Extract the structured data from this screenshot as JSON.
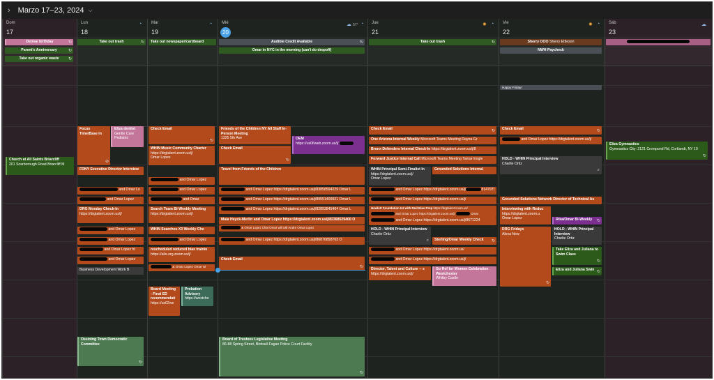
{
  "header": {
    "title": "Marzo 17–23, 2024",
    "prev_icon": "chevron-right-icon",
    "dropdown_icon": "chevron-down-icon"
  },
  "days": [
    {
      "name": "Dom",
      "num": "17"
    },
    {
      "name": "Lun",
      "num": "18"
    },
    {
      "name": "Mar",
      "num": "19"
    },
    {
      "name": "Mié",
      "num": "20",
      "weather": "57°"
    },
    {
      "name": "Jue",
      "num": "21"
    },
    {
      "name": "Vie",
      "num": "22"
    },
    {
      "name": "Sáb",
      "num": "23"
    }
  ],
  "allday": {
    "sun_1": "Denise birthday",
    "sun_2": "Parent's Anniversary",
    "sun_3": "Take out organic waste",
    "mon_1": "Take out trash",
    "tue_1": "Take out newspaper/cardboard",
    "wed_1": "Audible Credit Available",
    "wed_2": "Omar in NYC in the morning (can't do dropoff)",
    "thu_1": "Take out trash",
    "fri_1": "Sherry OOO",
    "fri_1b": "Sherry Ettleson",
    "fri_2": "NWH Paycheck",
    "fri_3": "Happy Friday!"
  },
  "events": {
    "sun_church_t": "Church at All Saints Briarcliff",
    "sun_church_l": "201 Scarborough Road Briarcliff M",
    "mon_focus_t": "Focus",
    "mon_focus_l": "Time/Base In",
    "mon_dentist_t": "Eliza dentist",
    "mon_dentist_l1": "Gentle Care",
    "mon_dentist_l2": "Pediatric",
    "mon_fdny": "FDNY Executive Director Interview",
    "mon_omar1": "and Omar Lo",
    "mon_omar2": "and Omar Lopez",
    "mon_drg_t": "DRG Monday Check-In",
    "mon_drg_l": "https://drgtalent.zoom.us/j/",
    "mon_omar3": "and Omar Lopez",
    "mon_omar4": "and Omar Lopez",
    "mon_omar5": "and Omar Lopez ht",
    "mon_omar6": "and Omar Lopez",
    "mon_bd": "Business Development Work B",
    "mon_ossining_t": "Ossining Town Democratic",
    "mon_ossining_t2": "Committee",
    "tue_check": "Check Email",
    "tue_whin_t": "WHIN Music Community Charter",
    "tue_whin_l": "https://drgtalent.zoom.us/j/",
    "tue_whin_l2": "Omar Lopez",
    "tue_omar1": "and Omar Lopez",
    "tue_omar2": "and Omar Lopez",
    "tue_omar3": "and Omar",
    "tue_search_t": "Search Team Bi-Weekly Meeting",
    "tue_search_l": "https://drgtalent.zoom.us/j/",
    "tue_whin2": "WHIN Searches X3 Weekly Che",
    "tue_omar4": "and Omar Lopez",
    "tue_resched_t": "rescheduled reduced bias trainin",
    "tue_resched_l": "https://alis-org.zoom.us/j/",
    "tue_omar5": "& Omar Lopez",
    "tue_omar5b": "Omar wi",
    "tue_board_t": "Board Meeting - Final ED recommendati",
    "tue_board_l": "https://us02we",
    "tue_prob_t": "Probation Advisory",
    "tue_prob_l": "https://westche",
    "wed_fotc_t": "Friends of the Children NY All Staff In-Person Meeting",
    "wed_fotc_l": "1325 5th Ave",
    "wed_oem_t": "OEM",
    "wed_oem_l": "https://us06web.zoom.us/j/",
    "wed_check": "Check Email",
    "wed_travel": "Travel from Friends of the Children",
    "wed_omar1": "and Omar Lopez https://drgtalent.zoom.us/j/83858594229 Omar L",
    "wed_omar2": "and Omar Lopez https://drgtalent.zoom.us/j/89551409921 Omar L",
    "wed_omar3": "and Omar Lopez https://drgtalent.zoom.us/j/82893845464 Omar L",
    "wed_maia": "Maia Heyck-Merlin and Omar Lopez https://drgtalent.zoom.us/j/82368529400 O",
    "wed_chat": "& Omar Lopez Chat",
    "wed_chat_b": "Omar will call Andre",
    "wed_chat_c": "Omar Lopez",
    "wed_omar4": "and Omar Lopez https://drgtalent.zoom.us/j/86876858763 O",
    "wed_check2": "Check Email",
    "wed_bot_t": "Board of Trustees Legislative Meeting",
    "wed_bot_l": "86-88 Spring Street, Birdsall-Fagan Police Court Facility",
    "thu_check": "Check Email",
    "thu_oneaz": "One Arizona Internal Weekly",
    "thu_oneaz_b": "Microsoft Teams Meeting Dayna Gr",
    "thu_bronx": "Bronx Defenders Internal Check-In",
    "thu_bronx_b": "https://drgtalent.zoom.us/j/8",
    "thu_fwd": "Forward Justice Internal Call",
    "thu_fwd_b": "Microsoft Teams Meeting Tamar Engle",
    "thu_whin_t": "WHIN Principal Semi-Finalist In",
    "thu_whin_l": "https://drgtalent.zoom.us/j/",
    "thu_whin_l2": "Omar Lopez",
    "thu_grounded": "Grounded Solutions Internal",
    "thu_omar1": "and Omar Lopez https://drgtalent.zoom.us/j/",
    "thu_omar1b": "814797582",
    "thu_omar2": "and Omar Lopez https://drgtalent.zoom.us/j/",
    "thu_hewlett": "Hewlett Foundation Int with Red Bias Prep",
    "thu_hewlett_b": "https://drgtalent.zoom.us/",
    "thu_omar3": "and Omar Lopez",
    "thu_omar3b": "https://drgtalent.zoom.us/j/",
    "thu_omar3c": "Omar",
    "thu_omar4": "and Omar Lopez https://drgtalent.zoom.us/j/8671224",
    "thu_hold_t": "HOLD - WHIN Principal Interview",
    "thu_hold_l": "Charlie Ortiz",
    "thu_sterling": "Sterling/Omar Weekly Check",
    "thu_omar5": "and Omar Lopez https://drgtalent.zoom.us/",
    "thu_omar6": "and Omar Lopez https://drgtalent.zoom.us/j/",
    "thu_director_t": "Director, Talent and Culture -- s",
    "thu_director_l": "https://drgtalent.zoom.us/j/",
    "thu_gofor_t": "Go Ref for Women Celebration Westchester",
    "thu_gofor_l": "Whitby Castle",
    "fri_check": "Check Email",
    "fri_omar1": "and Omar Lopez https://drgtalent.zoom.us/j/",
    "fri_hold_t": "HOLD - WHIN Principal Interview",
    "fri_hold_l": "Charlie Ortiz",
    "fri_grounded": "Grounded Solutions Network Director of Technical As",
    "fri_interview_t": "Interviewing with Reduc",
    "fri_interview_l": "https://drgtalent.zoom.u",
    "fri_interview_l2": "Omar Lopez",
    "fri_drg_t": "DRG Fridays",
    "fri_drg_l": "Alexa New",
    "fri_rika": "Rika/Omar Bi-Weekly",
    "fri_hold2_t": "HOLD - WHIN Principal Interview",
    "fri_hold2_l": "Charlie Ortiz",
    "fri_eliza_t": "Take Eliza and Juliana to Swim Class",
    "fri_eliza2": "Eliza and Juliana Swin",
    "sat_gym_t": "Eliza Gymnastics",
    "sat_gym_l": "Gymnastics City: 2121 Crompond Rd, Cortlandt, NY 10"
  }
}
